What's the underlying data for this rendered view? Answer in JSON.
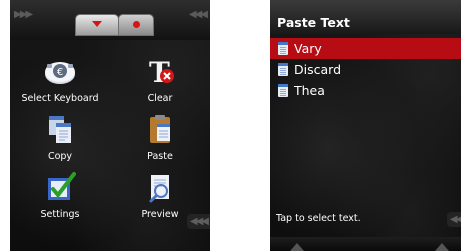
{
  "left_screen": {
    "top_bar": {
      "left_arrows": "▶▶▶",
      "right_arrows": "◀◀◀",
      "tabs": [
        {
          "icon": "dropdown-triangle-icon"
        },
        {
          "icon": "record-dot-icon"
        }
      ]
    },
    "grid": [
      {
        "label": "Select Keyboard",
        "icon": "keyboard-icon"
      },
      {
        "label": "Clear",
        "icon": "clear-text-icon"
      },
      {
        "label": "Copy",
        "icon": "copy-icon"
      },
      {
        "label": "Paste",
        "icon": "paste-icon"
      },
      {
        "label": "Settings",
        "icon": "settings-check-icon"
      },
      {
        "label": "Preview",
        "icon": "preview-icon"
      }
    ],
    "side_arrows": "◀◀◀"
  },
  "right_screen": {
    "title": "Paste Text",
    "items": [
      {
        "label": "Vary",
        "selected": true
      },
      {
        "label": "Discard",
        "selected": false
      },
      {
        "label": "Thea",
        "selected": false
      }
    ],
    "hint": "Tap to select text.",
    "side_arrows": "◀◀◀"
  },
  "colors": {
    "accent": "#d31717",
    "selection": "#b80c14",
    "background": "#111111"
  }
}
